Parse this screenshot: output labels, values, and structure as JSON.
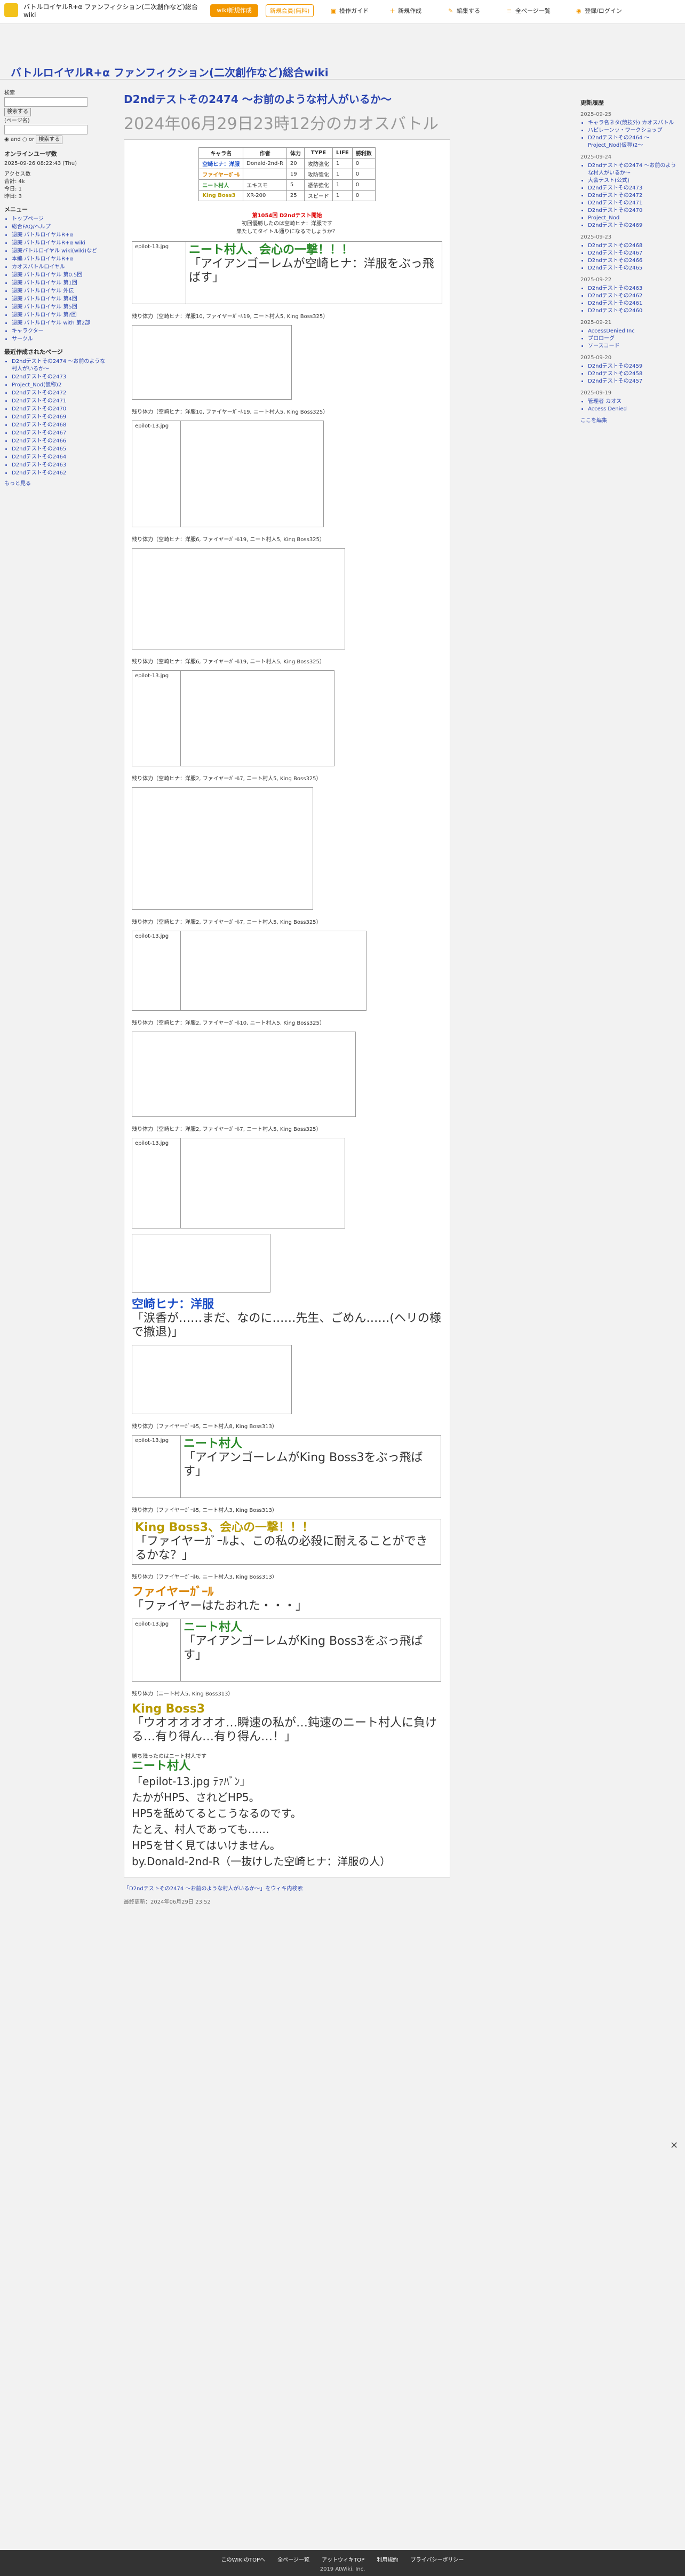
{
  "topbar": {
    "site_name": "バトルロイヤルR+α ファンフィクション(二次創作など)総合wiki",
    "btn_wiki_create": "wiki新規作成",
    "btn_wiki_create2": "wiki新規作成",
    "btn_member": "新規会員(無料)",
    "btn_notice": "新規会員(無料)",
    "links": [
      "操作ガイド",
      "新規作成",
      "編集する",
      "全ページ一覧",
      "登録/ログイン"
    ]
  },
  "header": {
    "wiki_title": "バトルロイヤルR+α ファンフィクション(二次創作など)総合wiki"
  },
  "left": {
    "search_label": "検索",
    "search_button": "検索する",
    "search_button2": "検索する",
    "and_label": "and",
    "or_label": "or",
    "page_search": "(ページ名)",
    "online_title": "オンラインユーザ数",
    "online_date": "2025-09-26 08:22:43 (Thu)",
    "access_lines": [
      "アクセス数",
      "合計: 4k",
      "今日: 1",
      "昨日: 3"
    ],
    "menu_title": "メニュー",
    "menu_items": [
      "トップページ",
      "総合FAQ/ヘルプ",
      "退廃 バトルロイヤルR+α",
      "退廃 バトルロイヤルR+α wiki",
      "退廃バトルロイヤル wiki(wiki)など",
      "本編 バトルロイヤルR+α",
      "カオスバトルロイヤル",
      "退廃 バトルロイヤル 第0.5回",
      "退廃 バトルロイヤル 第1回",
      "退廃 バトルロイヤル 外伝",
      "退廃 バトルロイヤル 第4回",
      "退廃 バトルロイヤル 第5回",
      "退廃 バトルロイヤル 第?回",
      "退廃 バトルロイヤル with 第2部",
      "キャラクター",
      "サークル"
    ],
    "recent_title": "最近作成されたページ",
    "recent_items": [
      "D2ndテストその2474 〜お前のような村人がいるか〜",
      "D2ndテストその2473",
      "Project_Nod(仮称)2",
      "D2ndテストその2472",
      "D2ndテストその2471",
      "D2ndテストその2470",
      "D2ndテストその2469",
      "D2ndテストその2468",
      "D2ndテストその2467",
      "D2ndテストその2466",
      "D2ndテストその2465",
      "D2ndテストその2464",
      "D2ndテストその2463",
      "D2ndテストその2462"
    ],
    "more_link": "もっと見る"
  },
  "right": {
    "title": "更新履歴",
    "groups": [
      {
        "date": "2025-09-25",
        "items": [
          "キャラ名ネタ(競技外) カオスバトル",
          "ハピレーンッ・ワークショップ",
          "D2ndテストその2464 〜Project_Nod(仮称)2〜"
        ]
      },
      {
        "date": "2025-09-24",
        "items": [
          "D2ndテストその2474 〜お前のような村人がいるか〜",
          "大会テスト(公式)",
          "D2ndテストその2473",
          "D2ndテストその2472",
          "D2ndテストその2471",
          "D2ndテストその2470",
          "Project_Nod",
          "D2ndテストその2469"
        ]
      },
      {
        "date": "2025-09-23",
        "items": [
          "D2ndテストその2468",
          "D2ndテストその2467",
          "D2ndテストその2466",
          "D2ndテストその2465"
        ]
      },
      {
        "date": "2025-09-22",
        "items": [
          "D2ndテストその2463",
          "D2ndテストその2462",
          "D2ndテストその2461",
          "D2ndテストその2460"
        ]
      },
      {
        "date": "2025-09-21",
        "items": [
          "AccessDenied Inc",
          "プロローグ",
          "ソースコード"
        ]
      },
      {
        "date": "2025-09-20",
        "items": [
          "D2ndテストその2459",
          "D2ndテストその2458",
          "D2ndテストその2457"
        ]
      },
      {
        "date": "2025-09-19",
        "items": [
          "管理者 カオス",
          "Access Denied"
        ]
      }
    ],
    "more_link": "ここを編集"
  },
  "main": {
    "page_title": "D2ndテストその2474 〜お前のような村人がいるか〜",
    "subtitle": "2024年06月29日23時12分のカオスバトル",
    "stat_headers": [
      "キャラ名",
      "作者",
      "体力",
      "TYPE",
      "LIFE",
      "勝利数"
    ],
    "stat_rows": [
      [
        "空崎ヒナ：洋服",
        "Donald-2nd-R",
        "20",
        "攻防強化",
        "1",
        "0"
      ],
      [
        "ファイヤーｶﾞｰﾙ",
        "",
        "19",
        "攻防強化",
        "1",
        "0"
      ],
      [
        "ニート村人",
        "エキスモ",
        "5",
        "憑依強化",
        "1",
        "0"
      ],
      [
        "King Boss3",
        "XR-200",
        "25",
        "スピード",
        "1",
        "0"
      ]
    ],
    "intro_lines": [
      "第1054回 D2ndテスト開始",
      "初回優勝したのは空崎ヒナ：洋服です",
      "果たしてタイトル通りになるでしょうか？"
    ],
    "turns": [
      "残り体力（空崎ヒナ：洋服10, ファイヤーｶﾞｰﾙ19, ニート村人5, King Boss325）",
      "残り体力（空崎ヒナ：洋服10, ファイヤーｶﾞｰﾙ19, ニート村人5, King Boss325）",
      "残り体力（空崎ヒナ：洋服6, ファイヤーｶﾞｰﾙ19, ニート村人5, King Boss325）",
      "残り体力（空崎ヒナ：洋服6, ファイヤーｶﾞｰﾙ19, ニート村人5, King Boss325）",
      "残り体力（空崎ヒナ：洋服2, ファイヤーｶﾞｰﾙ7, ニート村人5, King Boss325）",
      "残り体力（空崎ヒナ：洋服2, ファイヤーｶﾞｰﾙ7, ニート村人5, King Boss325）",
      "残り体力（空崎ヒナ：洋服2, ファイヤーｶﾞｰﾙ10, ニート村人5, King Boss325）",
      "残り体力（空崎ヒナ：洋服2, ファイヤーｶﾞｰﾙ7, ニート村人5, King Boss325）",
      "残り体力（ファイヤーｶﾞｰﾙ5, ニート村人8, King Boss313）",
      "残り体力（ファイヤーｶﾞｰﾙ5, ニート村人3, King Boss313）",
      "残り体力（ファイヤーｶﾞｰﾙ6, ニート村人3, King Boss313）",
      "残り体力（ニート村人5, King Boss313）"
    ],
    "big_lines": [
      "ニート村人、会心の一撃！！！",
      "「アイアンゴーレムが空崎ヒナ：洋服をぶっ飛ばす」",
      "空崎ヒナ：洋服",
      "「涙香が……まだ、なのに……先生、ごめん……(ヘリの様で撤退)」",
      "ニート村人",
      "「アイアンゴーレムがKing Boss3をぶっ飛ばす」",
      "King Boss3、会心の一撃！！！",
      "「ファイヤーｶﾞｰﾙよ、この私の必殺に耐えることができるかな？」",
      "ファイヤーｶﾞｰﾙ",
      "「ファイヤーはたおれた・・・」",
      "ニート村人",
      "「アイアンゴーレムがKing Boss3をぶっ飛ばす」",
      "King Boss3",
      "「ウオオオオオオ…瞬速の私が…鈍速のニート村人に負ける…有り得ん…有り得ん…！」"
    ],
    "ending_lines": [
      "勝ち残ったのはニート村人です",
      "ニート村人",
      "「epilot-13.jpg ﾃｧﾊﾞﾝ」",
      "たかがHP5、されどHP5。",
      "HP5を舐めてるとこうなるのです。",
      "たとえ、村人であっても……",
      "HP5を甘く見てはいけません。",
      "by.Donald-2nd-R（一抜けした空崎ヒナ：洋服の人）"
    ],
    "footer_link": "「D2ndテストその2474 〜お前のような村人がいるか〜」をウィキ内検索",
    "updated": "最終更新：2024年06月29日 23:52"
  },
  "footer": {
    "links": [
      "このWIKIのTOPへ",
      "全ページ一覧",
      "アットウィキTOP",
      "利用規約",
      "プライバシーポリシー"
    ],
    "copyright": "2019 AtWiki, Inc."
  },
  "colors": {
    "brand": "#f39800",
    "link": "#2a44b0",
    "hina": "#1e50c8",
    "fire": "#d98200",
    "villager": "#2a8a2a",
    "boss": "#b89a00"
  }
}
